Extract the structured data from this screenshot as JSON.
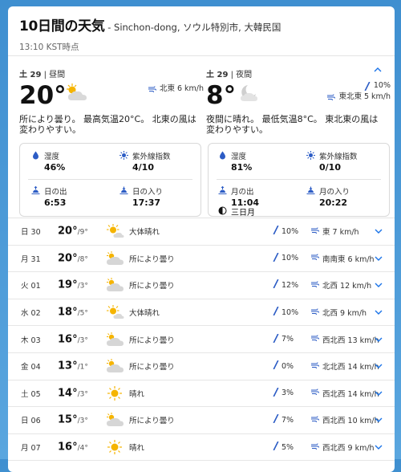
{
  "header": {
    "title": "10日間の天気",
    "location": " - Sinchon-dong, ソウル特別市, 大韓民国",
    "time": "13:10 KST時点"
  },
  "detail": {
    "day": {
      "date": "土 29",
      "period": "昼間",
      "temp": "20°",
      "wind": "北東 6 km/h",
      "description_1": "所により曇り。 最高気温20°C。 北東の風は",
      "description_2": "変わりやすい。",
      "stats": {
        "humidity_label": "湿度",
        "humidity": "46%",
        "uv_label": "紫外線指数",
        "uv": "4/10",
        "sunrise_label": "日の出",
        "sunrise": "6:53",
        "sunset_label": "日の入り",
        "sunset": "17:37"
      }
    },
    "night": {
      "date": "土 29",
      "period": "夜間",
      "temp": "8°",
      "rain": "10%",
      "wind": "東北東 5 km/h",
      "description_1": "夜間に晴れ。 最低気温8°C。 東北東の風は",
      "description_2": "変わりやすい。",
      "stats": {
        "humidity_label": "湿度",
        "humidity": "81%",
        "uv_label": "紫外線指数",
        "uv": "0/10",
        "moonrise_label": "月の出",
        "moonrise": "11:04",
        "moonset_label": "月の入り",
        "moonset": "20:22",
        "moon_phase": "三日月"
      }
    }
  },
  "forecast": [
    {
      "day": "日 30",
      "high": "20°",
      "low": "/9°",
      "icon": "sunny-partly-cloudy-icon",
      "desc": "大体晴れ",
      "rain": "10%",
      "wind": "東 7 km/h"
    },
    {
      "day": "月 31",
      "high": "20°",
      "low": "/8°",
      "icon": "cloudy-sun-icon",
      "desc": "所により曇り",
      "rain": "10%",
      "wind": "南南東 6 km/h"
    },
    {
      "day": "火 01",
      "high": "19°",
      "low": "/3°",
      "icon": "cloudy-sun-icon",
      "desc": "所により曇り",
      "rain": "12%",
      "wind": "北西 12 km/h"
    },
    {
      "day": "水 02",
      "high": "18°",
      "low": "/5°",
      "icon": "sunny-partly-cloudy-icon",
      "desc": "大体晴れ",
      "rain": "10%",
      "wind": "北西 9 km/h"
    },
    {
      "day": "木 03",
      "high": "16°",
      "low": "/3°",
      "icon": "cloudy-sun-icon",
      "desc": "所により曇り",
      "rain": "7%",
      "wind": "西北西 13 km/h"
    },
    {
      "day": "金 04",
      "high": "13°",
      "low": "/1°",
      "icon": "cloudy-sun-icon",
      "desc": "所により曇り",
      "rain": "0%",
      "wind": "北北西 14 km/h"
    },
    {
      "day": "土 05",
      "high": "14°",
      "low": "/3°",
      "icon": "sun-icon",
      "desc": "晴れ",
      "rain": "3%",
      "wind": "西北西 14 km/h"
    },
    {
      "day": "日 06",
      "high": "15°",
      "low": "/3°",
      "icon": "cloudy-sun-icon",
      "desc": "所により曇り",
      "rain": "7%",
      "wind": "西北西 10 km/h"
    },
    {
      "day": "月 07",
      "high": "16°",
      "low": "/4°",
      "icon": "sun-icon",
      "desc": "晴れ",
      "rain": "5%",
      "wind": "西北西 9 km/h"
    }
  ],
  "colors": {
    "accent": "#1a73e8",
    "icon_blue": "#2c5cc5",
    "sun": "#f5b400",
    "cloud": "#d5d5d5",
    "background": "#4a9ad8"
  }
}
